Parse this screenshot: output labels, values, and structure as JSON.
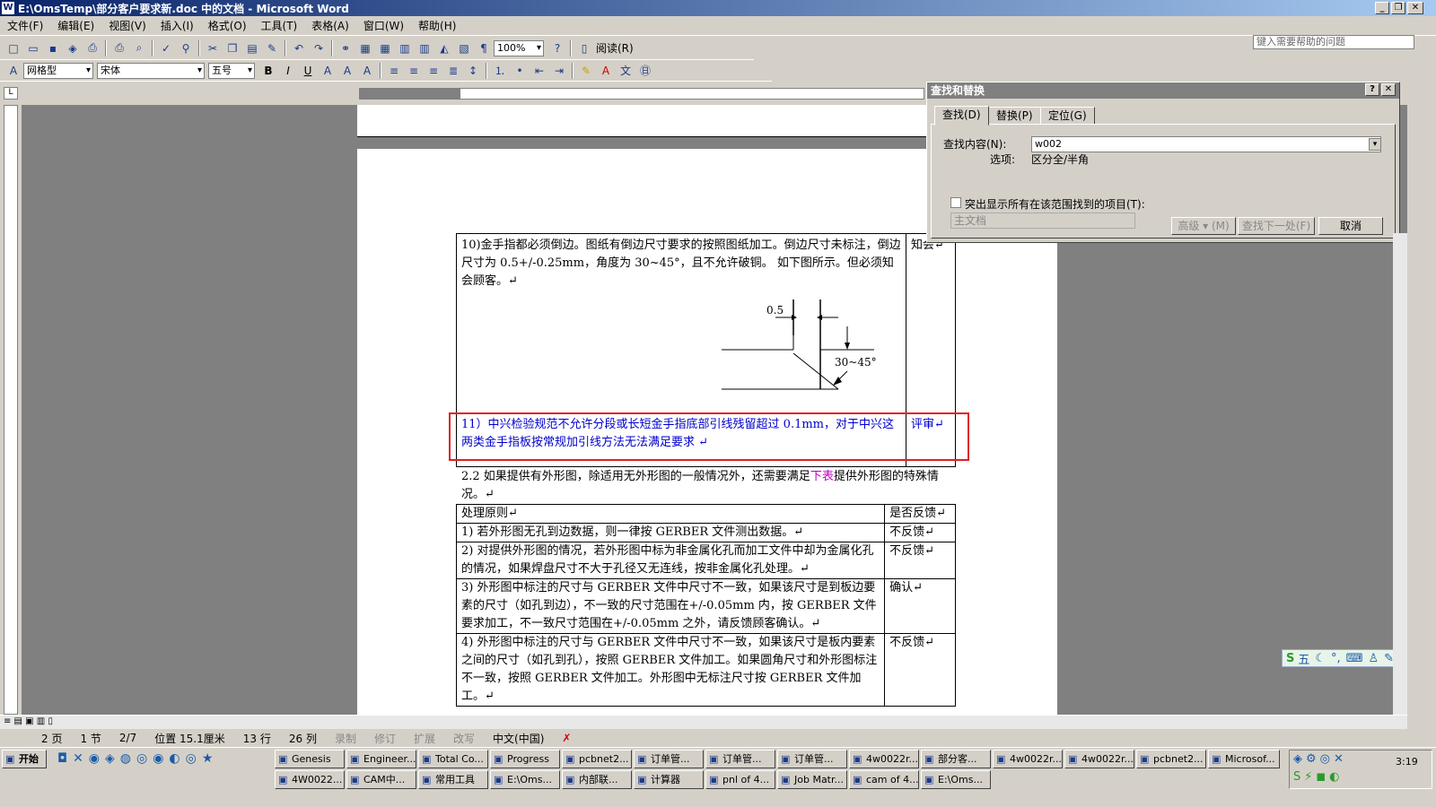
{
  "window": {
    "title": "E:\\OmsTemp\\部分客户要求新.doc 中的文档 - Microsoft Word"
  },
  "menu": [
    "文件(F)",
    "编辑(E)",
    "视图(V)",
    "插入(I)",
    "格式(O)",
    "工具(T)",
    "表格(A)",
    "窗口(W)",
    "帮助(H)"
  ],
  "help_placeholder": "键入需要帮助的问题",
  "toolbar": {
    "zoom": "100%",
    "read_label": "阅读(R)",
    "style": "网格型",
    "font": "宋体",
    "size": "五号"
  },
  "dialog": {
    "title": "查找和替换",
    "tabs": [
      "查找(D)",
      "替换(P)",
      "定位(G)"
    ],
    "find_label": "查找内容(N):",
    "find_value": "w002",
    "options_label": "选项:",
    "options_value": "区分全/半角",
    "highlight_label": "突出显示所有在该范围找到的项目(T):",
    "scope": "主文档",
    "btn_more": "高级 ▾ (M)",
    "btn_next": "查找下一处(F)",
    "btn_cancel": "取消"
  },
  "doc": {
    "row10_text": "10)金手指都必须倒边。图纸有倒边尺寸要求的按照图纸加工。倒边尺寸未标注，倒边尺寸为 0.5+/-0.25mm，角度为 30~45°，且不允许破铜。 如下图所示。但必须知会顾客。↵",
    "row10_right": "知会↵",
    "fig_dim": "0.5",
    "fig_angle": "30~45°",
    "row11_text": "11）中兴检验规范不允许分段或长短金手指底部引线残留超过 0.1mm，对于中兴这两类金手指板按常规加引线方法无法满足要求 ↵",
    "row11_right": "评审↵",
    "para_22a": "2.2 如果提供有外形图，除适用无外形图的一般情况外，还需要满足",
    "para_22b": "下表",
    "para_22c": "提供外形图的特殊情况。↵",
    "t2_header": [
      "处理原则↵",
      "是否反馈↵"
    ],
    "t2_rows": [
      [
        "1) 若外形图无孔到边数据，则一律按 GERBER 文件测出数据。↵",
        "不反馈↵"
      ],
      [
        "2) 对提供外形图的情况，若外形图中标为非金属化孔而加工文件中却为金属化孔的情况，如果焊盘尺寸不大于孔径又无连线，按非金属化孔处理。↵",
        "不反馈↵"
      ],
      [
        "3) 外形图中标注的尺寸与 GERBER 文件中尺寸不一致，如果该尺寸是到板边要素的尺寸（如孔到边），不一致的尺寸范围在+/-0.05mm 内，按 GERBER 文件要求加工，不一致尺寸范围在+/-0.05mm 之外，请反馈顾客确认。↵",
        "确认↵"
      ],
      [
        "4) 外形图中标注的尺寸与 GERBER 文件中尺寸不一致，如果该尺寸是板内要素之间的尺寸（如孔到孔），按照 GERBER 文件加工。如果圆角尺寸和外形图标注不一致，按照 GERBER 文件加工。外形图中无标注尺寸按 GERBER 文件加工。↵",
        "不反馈↵"
      ]
    ]
  },
  "status": {
    "page": "2 页",
    "section": "1 节",
    "pages": "2/7",
    "pos": "位置 15.1厘米",
    "line": "13 行",
    "col": "26 列",
    "rec": "录制",
    "trk": "修订",
    "ext": "扩展",
    "ovr": "改写",
    "lang": "中文(中国)"
  },
  "taskbar": {
    "start": "开始",
    "row1": [
      "Genesis",
      "Engineer...",
      "Total Co...",
      "Progress",
      "pcbnet2...",
      "订单管...",
      "订单管...",
      "订单管...",
      "4w0022r...",
      "部分客...",
      "4w0022r...",
      "4w0022r...",
      "pcbnet2...",
      "Microsof..."
    ],
    "row2": [
      "4W0022...",
      "CAM中...",
      "常用工具",
      "E:\\Oms...",
      "内部联...",
      "计算器",
      "pnl of 4...",
      "Job Matr...",
      "cam of 4...",
      "E:\\Oms..."
    ],
    "clock": "3:19"
  },
  "ime": "五",
  "colors": {
    "title_start": "#0a246a",
    "title_end": "#a6caf0",
    "highlight_box": "#e02020",
    "blue_text": "#0000cc"
  }
}
